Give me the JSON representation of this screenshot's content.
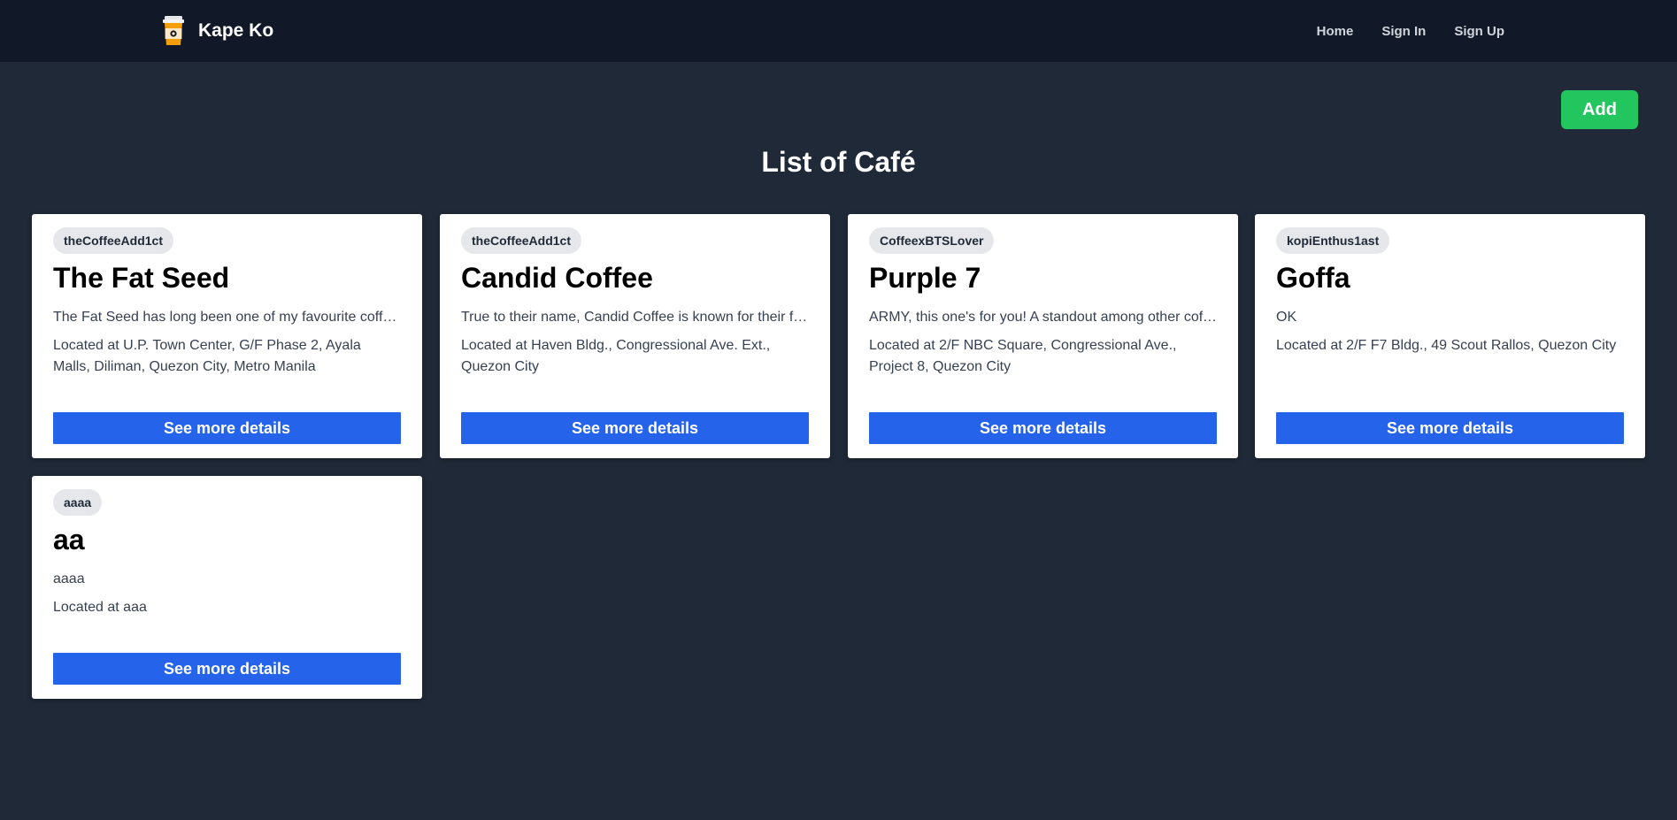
{
  "app": {
    "name": "Kape Ko",
    "logo_icon": "coffee-cup-icon"
  },
  "nav": {
    "items": [
      {
        "label": "Home"
      },
      {
        "label": "Sign In"
      },
      {
        "label": "Sign Up"
      }
    ]
  },
  "main": {
    "add_label": "Add",
    "title": "List of Café",
    "button_label": "See more details"
  },
  "colors": {
    "page_bg": "#1f2937",
    "navbar_bg": "#111827",
    "add_button": "#22c55e",
    "details_button": "#2563eb",
    "badge_bg": "#e5e7eb"
  },
  "cafes": [
    {
      "author": "theCoffeeAdd1ct",
      "name": "The Fat Seed",
      "description": "The Fat Seed has long been one of my favourite coffee...",
      "location": "Located at U.P. Town Center, G/F Phase 2, Ayala Malls, Diliman, Quezon City, Metro Manila"
    },
    {
      "author": "theCoffeeAdd1ct",
      "name": "Candid Coffee",
      "description": "True to their name, Candid Coffee is known for their friendly...",
      "location": "Located at Haven Bldg., Congressional Ave. Ext., Quezon City"
    },
    {
      "author": "CoffeexBTSLover",
      "name": "Purple 7",
      "description": "ARMY, this one's for you! A standout among other coffee...",
      "location": "Located at 2/F NBC Square, Congressional Ave., Project 8, Quezon City"
    },
    {
      "author": "kopiEnthus1ast",
      "name": "Goffa",
      "description": "OK",
      "location": "Located at 2/F F7 Bldg., 49 Scout Rallos, Quezon City"
    },
    {
      "author": "aaaa",
      "name": "aa",
      "description": "aaaa",
      "location": "Located at aaa"
    }
  ]
}
